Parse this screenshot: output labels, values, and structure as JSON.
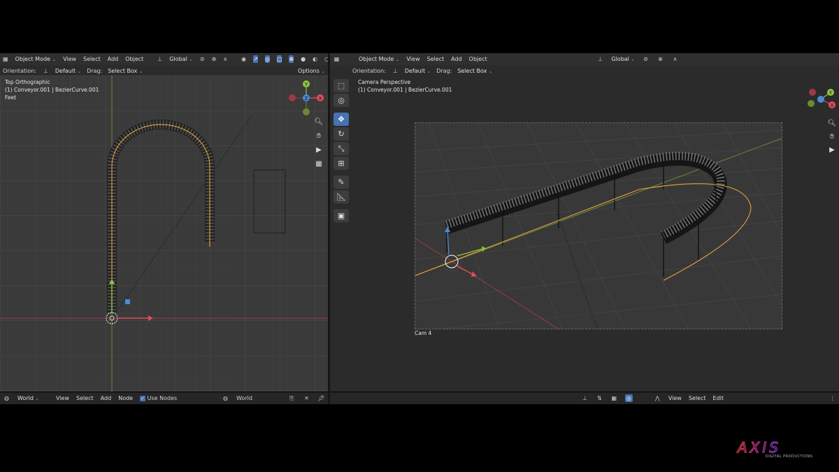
{
  "left_viewport": {
    "header": {
      "mode": "Object Mode",
      "menus": [
        "View",
        "Select",
        "Add",
        "Object"
      ],
      "transform_orientation": "Global"
    },
    "subheader": {
      "orientation_label": "Orientation:",
      "orientation_value": "Default",
      "drag_label": "Drag:",
      "drag_value": "Select Box",
      "options": "Options"
    },
    "overlay": {
      "view_name": "Top Orthographic",
      "object_info": "(1) Conveyor.001 | BezierCurve.001",
      "units": "Feet"
    },
    "gizmo": {
      "y": "Y",
      "x": "X",
      "z": "Z"
    }
  },
  "right_viewport": {
    "header": {
      "mode": "Object Mode",
      "menus": [
        "View",
        "Select",
        "Add",
        "Object"
      ],
      "transform_orientation": "Global"
    },
    "subheader": {
      "orientation_label": "Orientation:",
      "orientation_value": "Default",
      "drag_label": "Drag:",
      "drag_value": "Select Box"
    },
    "overlay": {
      "view_name": "Camera Perspective",
      "object_info": "(1) Conveyor.001 | BezierCurve.001",
      "camera_name": "Cam 4"
    },
    "gizmo": {
      "y": "Y",
      "x": "X"
    }
  },
  "bottom_left": {
    "world": "World",
    "menus": [
      "View",
      "Select",
      "Add",
      "Node"
    ],
    "use_nodes": "Use Nodes",
    "use_nodes_checked": true,
    "world_select": "World"
  },
  "bottom_right": {
    "menus": [
      "View",
      "Select",
      "Edit"
    ]
  },
  "watermark": {
    "brand": "AXIS",
    "tagline": "DIGITAL PRODUCTIONS"
  },
  "colors": {
    "accent": "#4772b3",
    "x_axis": "#e04c5c",
    "y_axis": "#8fc43f",
    "z_axis": "#4a8bd6",
    "curve": "#e8a23c"
  }
}
